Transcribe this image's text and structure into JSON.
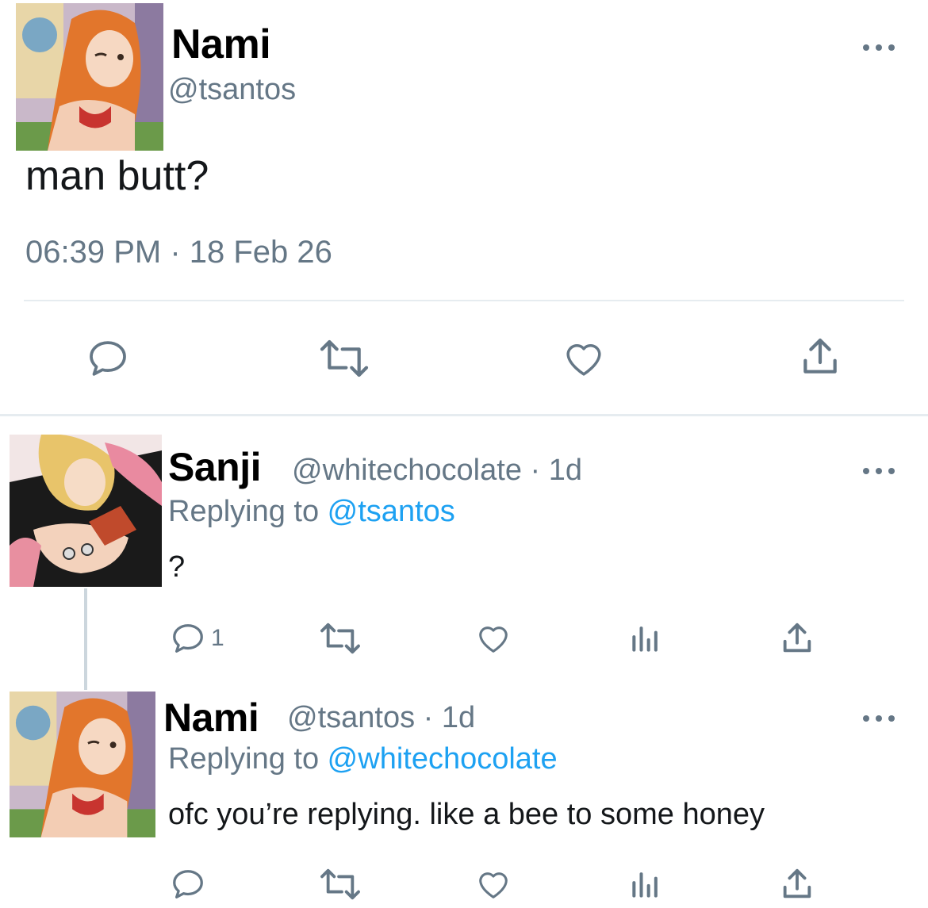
{
  "main_tweet": {
    "name": "Nami",
    "handle": "@tsantos",
    "text": "man butt?",
    "timestamp": "06:39 PM · 18 Feb 26",
    "avatar": "nami-avatar",
    "actions": [
      "reply-icon",
      "retweet-icon",
      "like-icon",
      "share-icon"
    ]
  },
  "replies": [
    {
      "name": "Sanji",
      "handle": "@whitechocolate · 1d",
      "replying_prefix": "Replying to ",
      "replying_to": "@tsantos",
      "text": "?",
      "reply_count": "1",
      "avatar": "sanji-avatar"
    },
    {
      "name": "Nami",
      "handle": "@tsantos · 1d",
      "replying_prefix": "Replying to ",
      "replying_to": "@whitechocolate",
      "text": "ofc you’re replying. like a bee to some honey",
      "reply_count": "",
      "avatar": "nami-avatar"
    }
  ],
  "colors": {
    "text": "#14171a",
    "secondary": "#657786",
    "link": "#1da1f2",
    "divider": "#e6ecf0"
  }
}
